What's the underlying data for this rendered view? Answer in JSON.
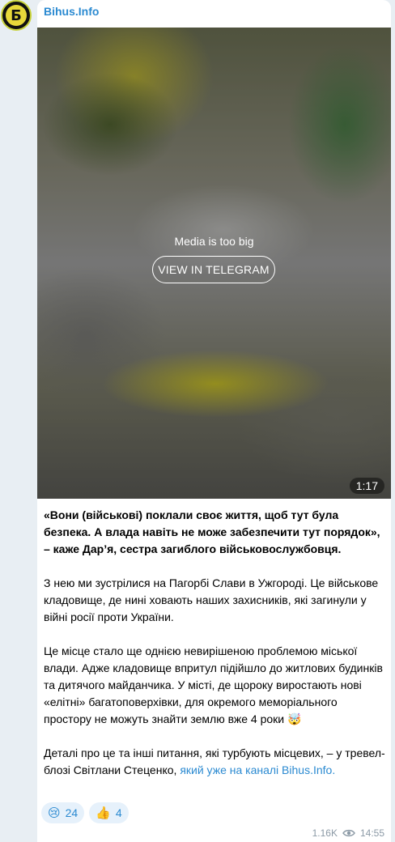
{
  "channel": {
    "name": "Bihus.Info",
    "avatar_letter": "Б"
  },
  "media": {
    "message": "Media is too big",
    "button_label": "VIEW IN TELEGRAM",
    "duration": "1:17"
  },
  "post": {
    "p1": "«Вони (військові) поклали своє життя, щоб тут була безпека. А влада навіть не може забезпечити тут порядок», – каже Дар’я, сестра загиблого військовослужбовця.",
    "p2": "З нею ми зустрілися на Пагорбі Слави в Ужгороді. Це військове кладовище, де нині ховають наших захисників, які загинули у війні росії проти України.",
    "p3": "Це місце стало ще однією невирішеною проблемою міської влади. Адже кладовище впритул підійшло до житлових будинків та дитячого майданчика. У місті, де щороку виростають нові «елітні» багатоповерхівки, для окремого меморіального простору не можуть знайти землю вже 4 роки 🤯",
    "p4_text": "Деталі про це та інші питання, які турбують місцевих, – у тревел-блозі Світлани Стеценко, ",
    "p4_link": "який уже на каналі Bihus.Info."
  },
  "reactions": [
    {
      "emoji": "😢",
      "count": "24"
    },
    {
      "emoji": "👍",
      "count": "4"
    }
  ],
  "meta": {
    "views": "1.16K",
    "time": "14:55"
  },
  "colors": {
    "accent": "#2b8ad1",
    "background": "#e8eef3"
  }
}
